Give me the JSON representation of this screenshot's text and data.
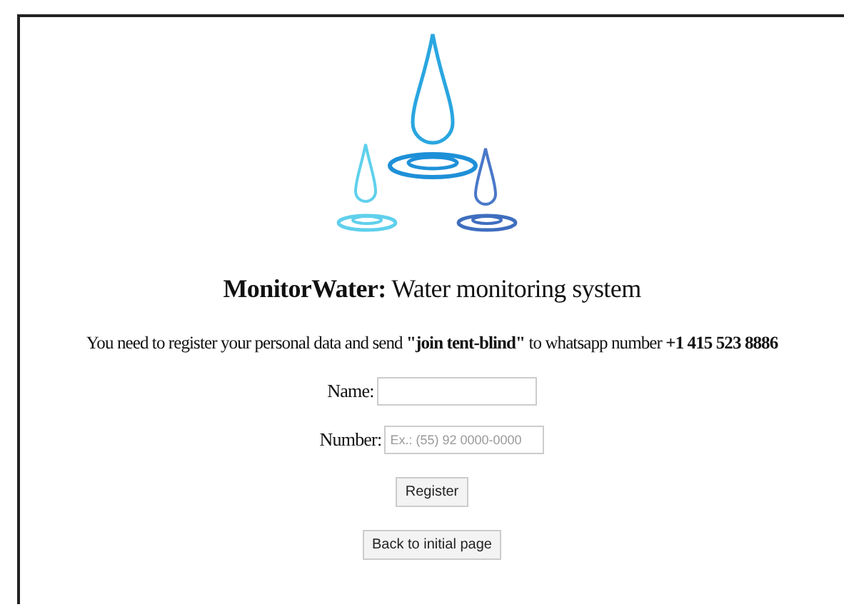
{
  "heading": "**MonitorWater:** Water monitoring system",
  "instructions": "You need to register your personal data and send **\"join tent-blind\"** to whatsapp number **+1 415 523 8886**",
  "form": {
    "fields": [
      {
        "label": "Name:"
      },
      {
        "label": "Number:",
        "placeholder": "Ex.: (55) 92 0000-0000"
      }
    ],
    "buttons": [
      "Register",
      "Back to initial page"
    ]
  }
}
